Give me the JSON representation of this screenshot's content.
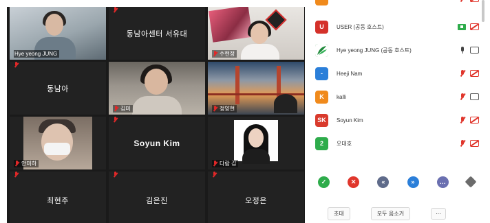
{
  "gallery": {
    "tiles": [
      {
        "name": "Hye yeong JUNG",
        "has_video": true
      },
      {
        "name": "동남아센터 서유대",
        "has_video": false
      },
      {
        "name": "수현정",
        "has_video": true
      },
      {
        "name": "동남아",
        "has_video": false
      },
      {
        "name": "김미",
        "has_video": true
      },
      {
        "name": "정양현",
        "has_video": true
      },
      {
        "name": "안미하",
        "has_video": true
      },
      {
        "name": "Soyun Kim",
        "has_video": false
      },
      {
        "name": "다람 김",
        "has_video": true
      },
      {
        "name": "최현주",
        "has_video": false
      },
      {
        "name": "김은진",
        "has_video": false
      },
      {
        "name": "오정은",
        "has_video": false
      }
    ]
  },
  "participants": {
    "rows": [
      {
        "initial": "U",
        "name": "USER (공동 호스트)",
        "avatar_color": "#d4312a",
        "icons": [
          "share",
          "cam-off"
        ]
      },
      {
        "initial": "",
        "name": "Hye yeong JUNG (공동 호스트)",
        "avatar_color": "#1f8a3b",
        "icons": [
          "mic-on",
          "cam-on"
        ]
      },
      {
        "initial": "-",
        "name": "Heeji Nam",
        "avatar_color": "#2b7fd9",
        "icons": [
          "mic-off",
          "cam-off"
        ]
      },
      {
        "initial": "K",
        "name": "kalli",
        "avatar_color": "#f08a1c",
        "icons": [
          "mic-off",
          "cam-on"
        ]
      },
      {
        "initial": "SK",
        "name": "Soyun Kim",
        "avatar_color": "#d93a2c",
        "icons": [
          "mic-off",
          "cam-off"
        ]
      },
      {
        "initial": "2",
        "name": "오대호",
        "avatar_color": "#2eac4b",
        "icons": [
          "mic-off",
          "cam-off"
        ]
      }
    ]
  },
  "reactions": [
    {
      "glyph": "✓",
      "color": "#2eac4b",
      "name": "yes"
    },
    {
      "glyph": "✕",
      "color": "#e0362c",
      "name": "no"
    },
    {
      "glyph": "«",
      "color": "#5f6b8a",
      "name": "go-slower"
    },
    {
      "glyph": "»",
      "color": "#2b7fd9",
      "name": "go-faster"
    },
    {
      "glyph": "…",
      "color": "#6a6fb0",
      "name": "more"
    },
    {
      "glyph": "",
      "color": "#6b6b6b",
      "name": "coffee"
    }
  ],
  "footer": {
    "invite_label": "초대",
    "mute_all_label": "모두 음소거",
    "more_label": "..."
  }
}
